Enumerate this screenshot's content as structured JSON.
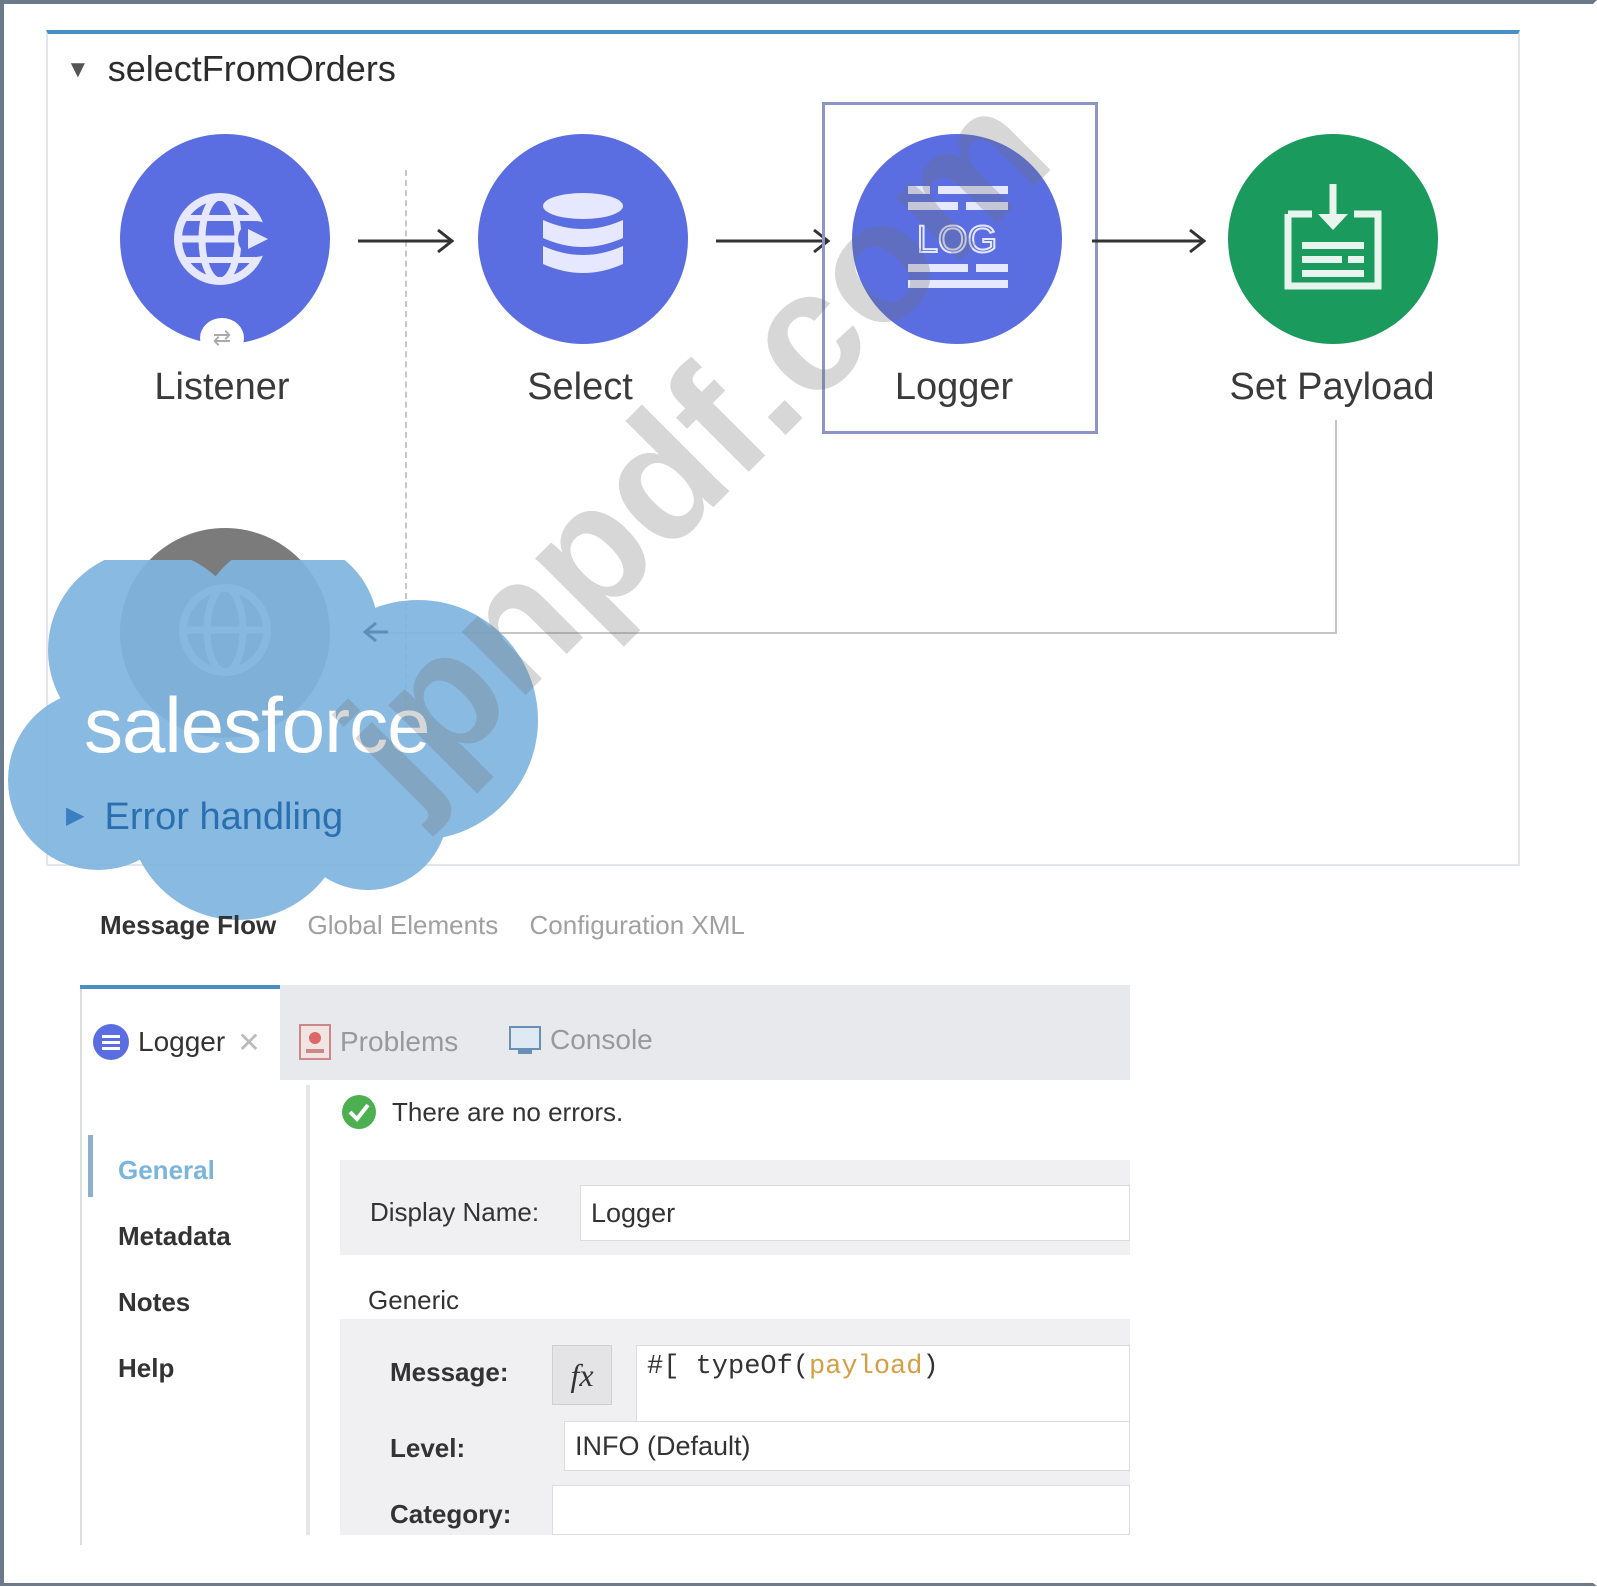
{
  "flow": {
    "name": "selectFromOrders",
    "nodes": [
      {
        "label": "Listener",
        "icon": "globe-listener-icon",
        "color": "#5b6ee1"
      },
      {
        "label": "Select",
        "icon": "database-icon",
        "color": "#5b6ee1"
      },
      {
        "label": "Logger",
        "icon": "log-icon",
        "color": "#5b6ee1",
        "selected": true
      },
      {
        "label": "Set Payload",
        "icon": "set-payload-icon",
        "color": "#1a9a5c"
      }
    ],
    "error_handling_label": "Error handling"
  },
  "overlay_logo_text": "salesforce",
  "watermark_text": "jpnpdf.com",
  "editor_tabs": [
    "Message Flow",
    "Global Elements",
    "Configuration XML"
  ],
  "panel": {
    "tabs": [
      {
        "label": "Logger",
        "close": "✕"
      },
      {
        "label": "Problems"
      },
      {
        "label": "Console"
      }
    ],
    "nav": [
      "General",
      "Metadata",
      "Notes",
      "Help"
    ],
    "status": "There are no errors.",
    "display_name_label": "Display Name:",
    "display_name_value": "Logger",
    "generic_label": "Generic",
    "message_label": "Message:",
    "message_fx": "fx",
    "message_prefix": "#[ typeOf(",
    "message_payload": "payload",
    "message_suffix": ")",
    "level_label": "Level:",
    "level_value": "INFO (Default)",
    "category_label": "Category:",
    "category_value": ""
  }
}
